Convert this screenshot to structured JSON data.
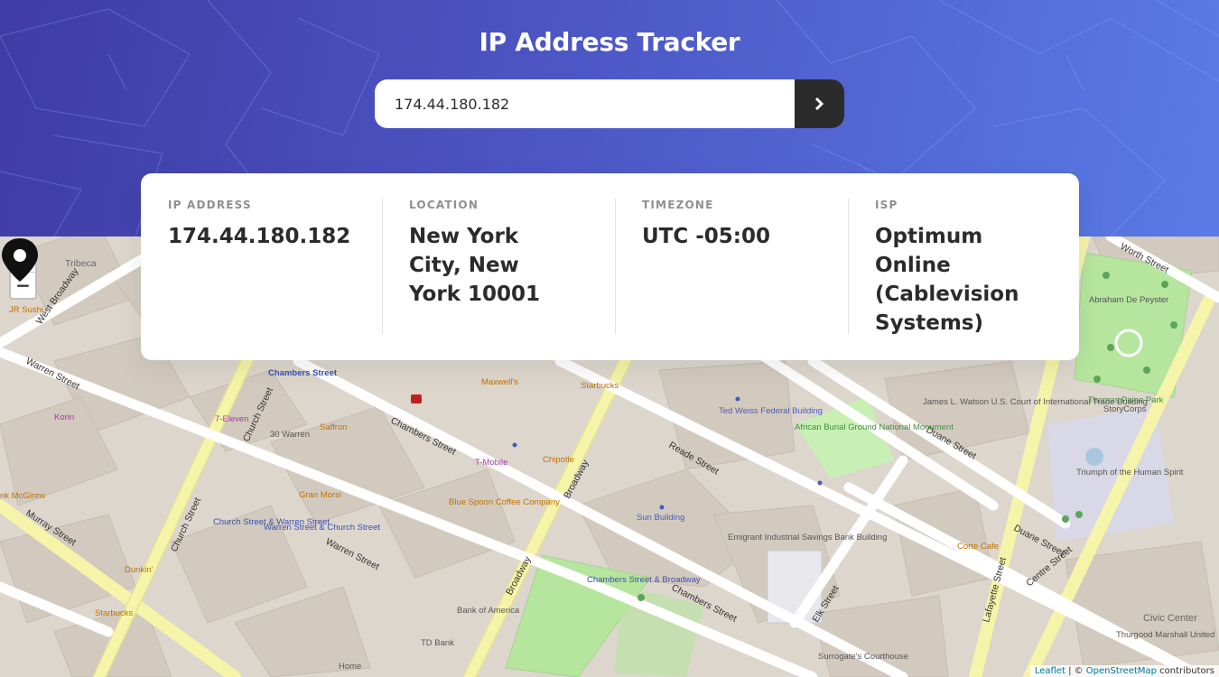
{
  "header": {
    "title": "IP Address Tracker",
    "search_value": "174.44.180.182",
    "submit_icon": "chevron-right-icon"
  },
  "info": {
    "ip_label": "IP ADDRESS",
    "ip_value": "174.44.180.182",
    "location_label": "LOCATION",
    "location_value": "New York City, New York 10001",
    "timezone_label": "TIMEZONE",
    "timezone_value": "UTC -05:00",
    "isp_label": "ISP",
    "isp_value": "Optimum Online (Cablevision Systems)"
  },
  "map": {
    "zoom_in": "+",
    "zoom_out": "−",
    "attribution_leaflet": "Leaflet",
    "attribution_sep": " | © ",
    "attribution_osm": "OpenStreetMap",
    "attribution_suffix": " contributors",
    "marker_icon": "location-pin-icon",
    "labels": {
      "chambers_street": "Chambers Street",
      "warren_street": "Warren Street",
      "reade_street": "Reade Street",
      "duane_street": "Duane Street",
      "murray_street": "Murray Street",
      "broadway": "Broadway",
      "church_street": "Church Street",
      "centre_street": "Centre Street",
      "lafayette_street": "Lafayette Street",
      "elk_street": "Elk Street",
      "worth_street": "Worth Street",
      "west_broadway": "West Broadway",
      "tribeca": "Tribeca",
      "sun_building": "Sun Building",
      "ted_weiss": "Ted Weiss Federal Building",
      "african_burial": "African Burial Ground National Monument",
      "emigrant": "Emigrant Industrial Savings Bank Building",
      "surrogates": "Surrogate's Courthouse",
      "thurgood": "Thurgood Marshall United",
      "civic_center": "Civic Center",
      "paine_park": "Thomas Paine Park",
      "storycorps": "StoryCorps",
      "starbucks": "Starbucks",
      "chipotle": "Chipotle",
      "tmobile": "T-Mobile",
      "blue_spoon": "Blue Spoon Coffee Company",
      "maxwells": "Maxwell's",
      "gran_morsi": "Gran Morsi",
      "saffron": "Saffron",
      "dunkin": "Dunkin'",
      "seven_eleven": "7-Eleven",
      "korin": "Korin",
      "td_bank": "TD Bank",
      "bank_of_america": "Bank of America",
      "corte_cafe": "Corte Cafe",
      "james_watson": "James L. Watson U.S. Court of International Trade Building",
      "abraham": "Abraham De Peyster",
      "triumph": "Triumph of the Human Spirit",
      "chambers_station": "Chambers Street",
      "church_warren": "Church Street & Warren Street",
      "warren_church": "Warren Street & Church Street",
      "chambers_broadway": "Chambers Street & Broadway",
      "thirty_warren": "30 Warren",
      "jr_sushi": "JR Sushi",
      "mcginns": "nk McGinns",
      "home": "Home"
    }
  }
}
